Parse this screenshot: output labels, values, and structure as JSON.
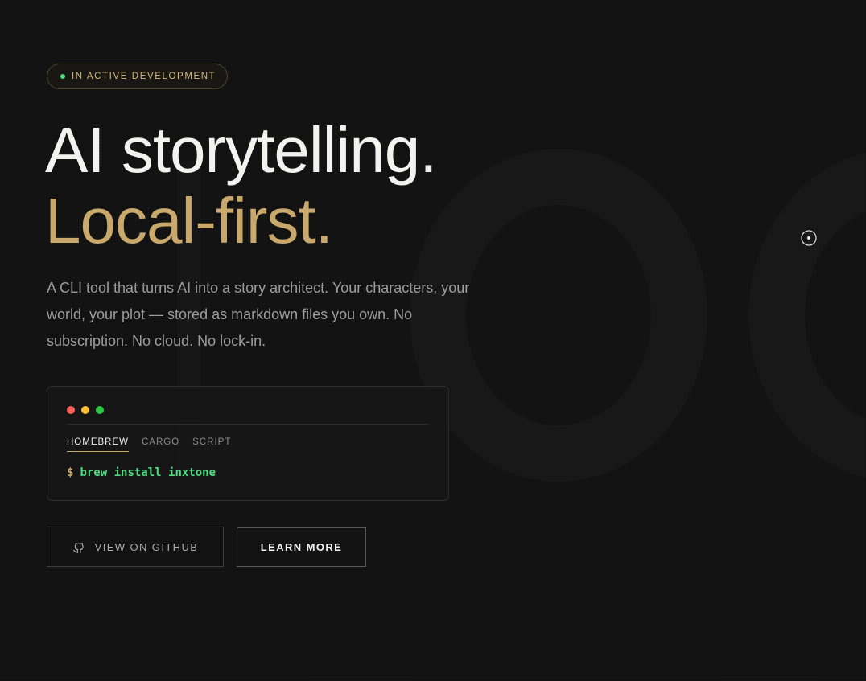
{
  "badge": {
    "label": "IN ACTIVE DEVELOPMENT",
    "dot_color": "#4ade80"
  },
  "hero": {
    "line1": "AI storytelling.",
    "line2": "Local-first.",
    "description": "A CLI tool that turns AI into a story architect. Your characters, your world, your plot — stored as markdown files you own. No subscription. No cloud. No lock-in."
  },
  "terminal": {
    "tabs": [
      {
        "label": "HOMEBREW",
        "active": true
      },
      {
        "label": "CARGO",
        "active": false
      },
      {
        "label": "SCRIPT",
        "active": false
      }
    ],
    "prompt": "$",
    "command": "brew install inxtone"
  },
  "buttons": {
    "github_label": "VIEW ON GITHUB",
    "learn_label": "LEARN MORE"
  },
  "icons": {
    "github": "github-icon",
    "target": "target-icon",
    "window_controls": [
      "close-dot",
      "minimize-dot",
      "maximize-dot"
    ]
  },
  "colors": {
    "background": "#111111",
    "accent_gold": "#c9a86b",
    "accent_green": "#4ade80",
    "text_primary": "#f2f2ee",
    "text_muted": "#9c9c9c"
  }
}
